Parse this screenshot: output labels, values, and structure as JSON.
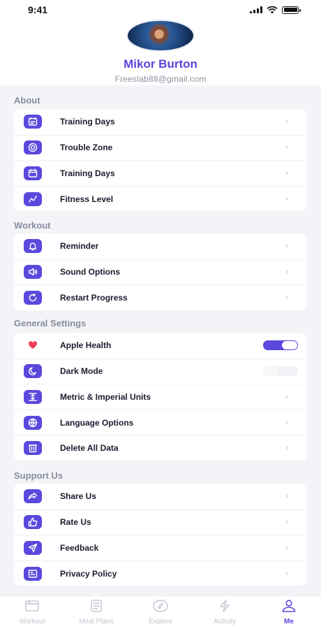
{
  "status_bar": {
    "time": "9:41"
  },
  "profile": {
    "name": "Mikor Burton",
    "email": "Freeslab88@gmail.com"
  },
  "colors": {
    "accent": "#5b48dd",
    "background": "#f3f4f7"
  },
  "sections": [
    {
      "title": "About",
      "items": [
        {
          "label": "Training Days",
          "icon": "calendar-days-icon"
        },
        {
          "label": "Trouble Zone",
          "icon": "target-icon"
        },
        {
          "label": "Training Days",
          "icon": "calendar-icon"
        },
        {
          "label": "Fitness Level",
          "icon": "level-icon"
        }
      ]
    },
    {
      "title": "Workout",
      "items": [
        {
          "label": "Reminder",
          "icon": "bell-icon"
        },
        {
          "label": "Sound Options",
          "icon": "speaker-icon"
        },
        {
          "label": "Restart Progress",
          "icon": "restart-icon"
        }
      ]
    },
    {
      "title": "General Settings",
      "items": [
        {
          "label": "Apple Health",
          "icon": "heart-icon",
          "toggle": true
        },
        {
          "label": "Dark Mode",
          "icon": "moon-icon",
          "toggle": false
        },
        {
          "label": "Metric & Imperial Units",
          "icon": "units-icon"
        },
        {
          "label": "Language Options",
          "icon": "globe-icon"
        },
        {
          "label": "Delete All Data",
          "icon": "trash-icon"
        }
      ]
    },
    {
      "title": "Support Us",
      "items": [
        {
          "label": "Share Us",
          "icon": "share-icon"
        },
        {
          "label": "Rate Us",
          "icon": "thumbs-up-icon"
        },
        {
          "label": "Feedback",
          "icon": "send-icon"
        },
        {
          "label": "Privacy Policy",
          "icon": "document-icon"
        }
      ]
    }
  ],
  "tabs": [
    {
      "label": "Workout",
      "icon": "workout-icon",
      "active": false
    },
    {
      "label": "Meal Plans",
      "icon": "meal-plans-icon",
      "active": false
    },
    {
      "label": "Explore",
      "icon": "compass-icon",
      "active": false
    },
    {
      "label": "Activity",
      "icon": "lightning-icon",
      "active": false
    },
    {
      "label": "Me",
      "icon": "person-icon",
      "active": true
    }
  ]
}
